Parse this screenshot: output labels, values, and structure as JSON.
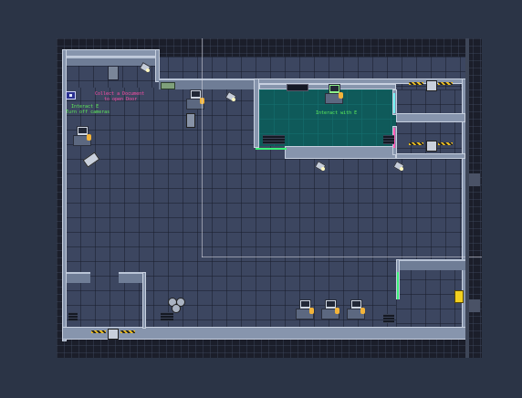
{
  "game": {
    "title": "",
    "hints": {
      "interact_cameras": "Interact E\nTurn off cameras",
      "collect_document": "Collect a Document\nto open Door",
      "interact_terminal": "Interact with E"
    }
  },
  "colors": {
    "background": "#2b3446",
    "floor": "#3c4660",
    "wall": "#8795ad",
    "secure_room": "#0f5a5a",
    "hint_green": "#5ff05a",
    "hint_pink": "#ff4ea8",
    "laser_green": "#3cf07a",
    "laser_cyan": "#6ff0f0",
    "exit_yellow": "#f2d020"
  },
  "icons": {
    "player": "blue-square",
    "camera": "security-camera-icon",
    "terminal": "computer-terminal-icon",
    "document": "document-icon",
    "exit": "exit-door-icon"
  }
}
